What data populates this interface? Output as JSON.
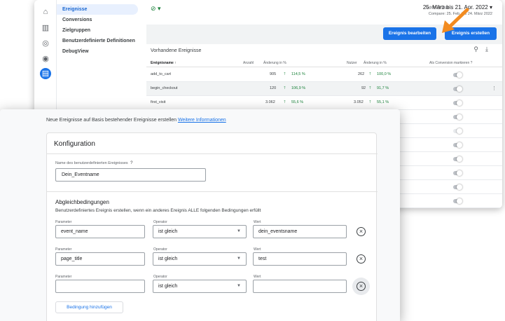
{
  "nav": {
    "items": [
      {
        "label": "Ereignisse",
        "active": true
      },
      {
        "label": "Conversions",
        "active": false
      },
      {
        "label": "Zielgruppen",
        "active": false
      },
      {
        "label": "Benutzerdefinierte Definitionen",
        "active": false
      },
      {
        "label": "DebugView",
        "active": false
      }
    ]
  },
  "rail": {
    "icons": [
      "home-icon",
      "reports-icon",
      "explore-icon",
      "advertising-icon",
      "configure-icon"
    ]
  },
  "topbar": {
    "status_symbol": "⊘ ▾",
    "date_label": "Letzte 28 Tage",
    "date_range": "25. März bis 21. Apr. 2022 ▾",
    "compare_range": "Compare: 25. Feb. bis 24. März 2022"
  },
  "buttons": {
    "edit_event": "Ereignis bearbeiten",
    "create_event": "Ereignis erstellen"
  },
  "events_table": {
    "title": "Vorhandene Ereignisse",
    "columns": [
      "Ereignisname ↑",
      "Anzahl",
      "Änderung in %",
      "Nutzer",
      "Änderung in %",
      "Als Conversion markieren ?"
    ],
    "rows": [
      {
        "name": "add_to_cart",
        "count": "905",
        "count_change": "114,5 %",
        "users": "262",
        "users_change": "100,0 %"
      },
      {
        "name": "begin_checkout",
        "count": "120",
        "count_change": "106,9 %",
        "users": "92",
        "users_change": "91,7 %"
      },
      {
        "name": "first_visit",
        "count": "3.062",
        "count_change": "55,6 %",
        "users": "3.052",
        "users_change": "55,1 %"
      }
    ]
  },
  "dialog": {
    "intro_text": "Neue Ereignisse auf Basis bestehender Ereignisse erstellen",
    "intro_link": "Weitere Informationen",
    "config_title": "Konfiguration",
    "name_label": "Name des benutzerdefinierten Ereignisses",
    "name_value": "Dein_Eventname",
    "match_title": "Abgleichbedingungen",
    "match_desc": "Benutzerdefiniertes Ereignis erstellen, wenn ein anderes Ereignis ALLE folgenden Bedingungen erfüllt",
    "labels": {
      "parameter": "Parameter",
      "operator": "Operator",
      "value": "Wert"
    },
    "conditions": [
      {
        "parameter": "event_name",
        "operator": "ist gleich",
        "value": "dein_eventsname"
      },
      {
        "parameter": "page_title",
        "operator": "ist gleich",
        "value": "test"
      },
      {
        "parameter": "",
        "operator": "ist gleich",
        "value": ""
      }
    ],
    "add_condition": "Bedingung hinzufügen"
  },
  "colors": {
    "accent": "#1a73e8",
    "positive": "#188038",
    "highlight_arrow": "#f28b20"
  }
}
